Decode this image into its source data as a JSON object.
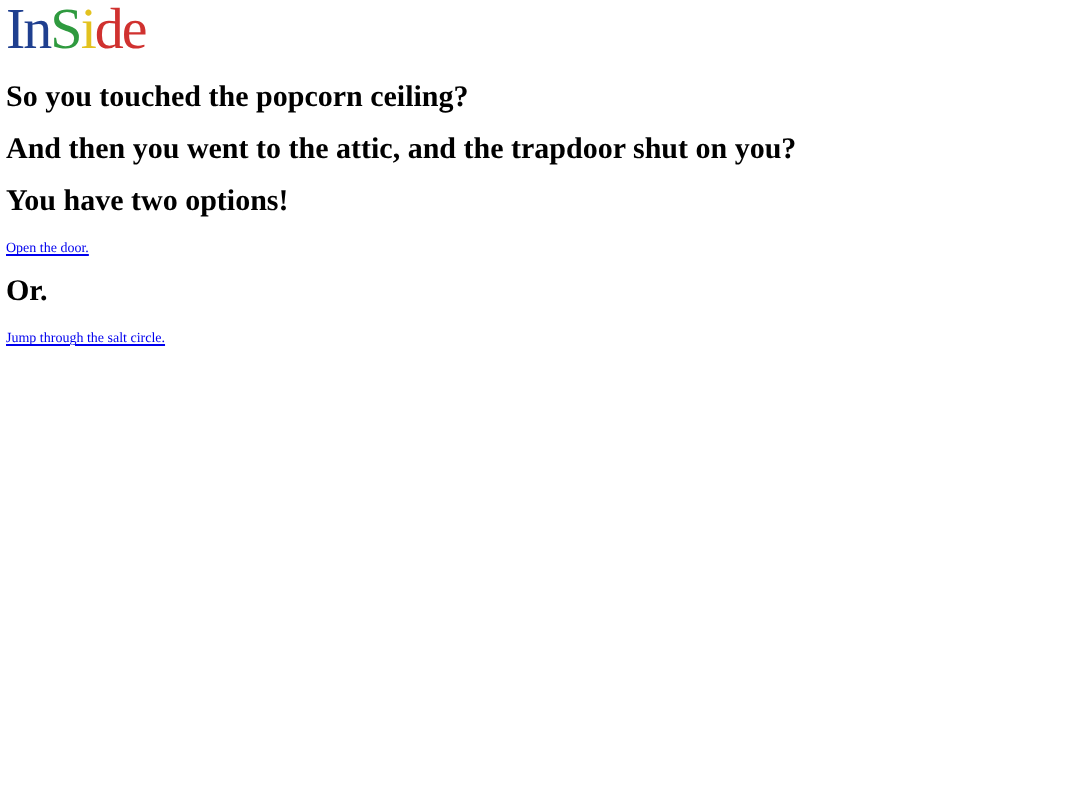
{
  "logo": {
    "letters": [
      {
        "char": "I",
        "color": "#1f3f8f"
      },
      {
        "char": "n",
        "color": "#1f3f8f"
      },
      {
        "char": "S",
        "color": "#2f9a3f"
      },
      {
        "char": "i",
        "color": "#e3c21f"
      },
      {
        "char": "d",
        "color": "#d0312f"
      },
      {
        "char": "e",
        "color": "#d0312f"
      }
    ]
  },
  "content": [
    {
      "kind": "heading",
      "text": "So you touched the popcorn ceiling?"
    },
    {
      "kind": "heading",
      "text": "And then you went to the attic, and the trapdoor shut on you?"
    },
    {
      "kind": "heading",
      "text": "You have two options!"
    },
    {
      "kind": "link",
      "text": "Open the door."
    },
    {
      "kind": "heading",
      "text": "Or."
    },
    {
      "kind": "link",
      "text": "Jump through the salt circle."
    }
  ]
}
